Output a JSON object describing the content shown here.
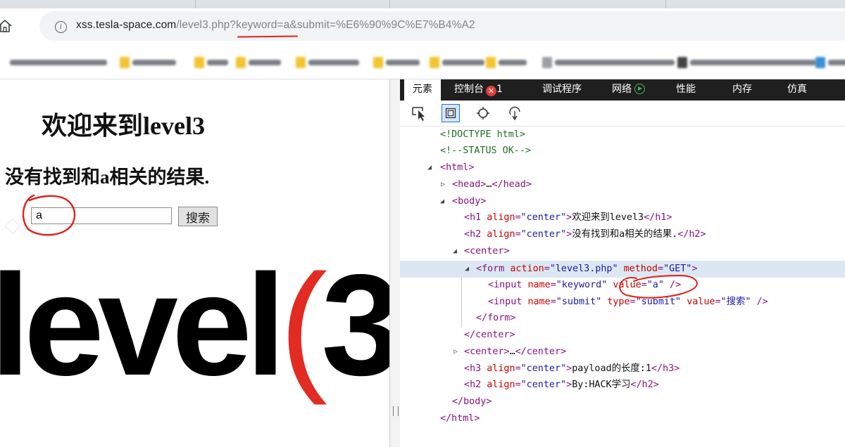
{
  "browser": {
    "address_bar": {
      "url_host": "xss.tesla-space.com",
      "url_rest": "/level3.php?keyword=a&submit=%E6%90%9C%E7%B4%A2"
    }
  },
  "page": {
    "h1": "欢迎来到level3",
    "h2": "没有找到和a相关的结果.",
    "form": {
      "keyword_value": "a",
      "submit_label": "搜索"
    },
    "logo": {
      "text": "level",
      "number": "3",
      "paren_open": "(",
      "paren_close": ")"
    }
  },
  "devtools": {
    "tabs": [
      {
        "label": "元素"
      },
      {
        "label": "控制台"
      },
      {
        "label": "调试程序"
      },
      {
        "label": "网络"
      },
      {
        "label": "性能"
      },
      {
        "label": "内存"
      },
      {
        "label": "仿真"
      }
    ],
    "console_error_count": "1",
    "toolbar_icons": [
      "select-element-icon",
      "highlight-box-icon",
      "circle-icon",
      "touch-icon"
    ],
    "dom": {
      "doctype": "<!DOCTYPE html>",
      "comment": "<!--STATUS OK-->",
      "h1_text": "欢迎来到level3",
      "h2_text": "没有找到和a相关的结果.",
      "form_action": "\"level3.php\"",
      "form_method": "\"GET\"",
      "input1_name": "\"keyword\"",
      "input1_value": "\"a\"",
      "input2_name": "\"submit\"",
      "input2_type": "\"submit\"",
      "input2_value": "\"搜索\"",
      "h3_text": "payload的长度:1",
      "h2b_text": "By:HACK学习",
      "align_center": "\"center\""
    }
  },
  "colors": {
    "annotation_red": "#e0201b",
    "devtools_tabbar": "#1f1f1f",
    "selected_row": "#dbe8f3"
  }
}
